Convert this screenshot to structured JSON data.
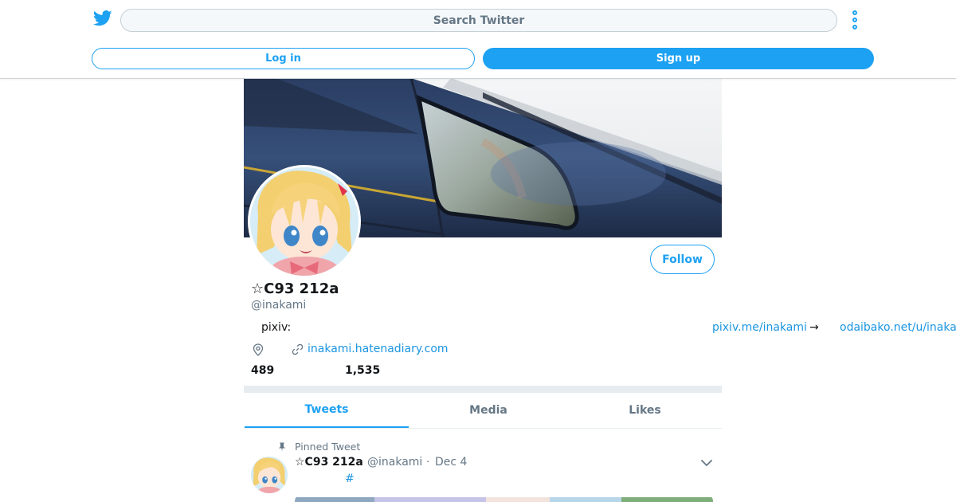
{
  "header": {
    "logo_icon": "twitter-bird-icon",
    "search_placeholder": "Search Twitter",
    "more_icon": "more-vertical-icon",
    "login_label": "Log in",
    "signup_label": "Sign up",
    "accent_color": "#1da1f2"
  },
  "profile": {
    "display_name": "☆C93 212a",
    "handle": "@inakami",
    "follow_label": "Follow",
    "bio": {
      "label": "pixiv:",
      "link1": "pixiv.me/inakami",
      "arrow": "→",
      "link2": "odaibako.net/u/inakami"
    },
    "location_icon": "location-pin-icon",
    "link_icon": "link-icon",
    "website": "inakami.hatenadiary.com",
    "stats": {
      "following": "489",
      "followers": "1,535"
    }
  },
  "tabs": [
    {
      "label": "Tweets",
      "active": true
    },
    {
      "label": "Media",
      "active": false
    },
    {
      "label": "Likes",
      "active": false
    }
  ],
  "tweet": {
    "pinned_label": "Pinned Tweet",
    "name": "☆C93 212a",
    "handle": "@inakami",
    "separator": "·",
    "date": "Dec 4",
    "hashtag": "#",
    "menu_icon": "chevron-down-icon"
  }
}
